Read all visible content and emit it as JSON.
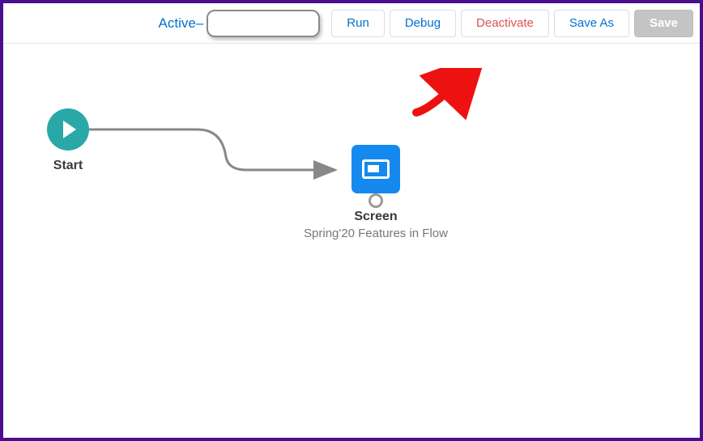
{
  "toolbar": {
    "status_prefix": "Active–",
    "run": "Run",
    "debug": "Debug",
    "deactivate": "Deactivate",
    "save_as": "Save As",
    "save": "Save"
  },
  "nodes": {
    "start": {
      "title": "Start"
    },
    "screen": {
      "title": "Screen",
      "subtitle": "Spring'20 Features in Flow"
    }
  }
}
